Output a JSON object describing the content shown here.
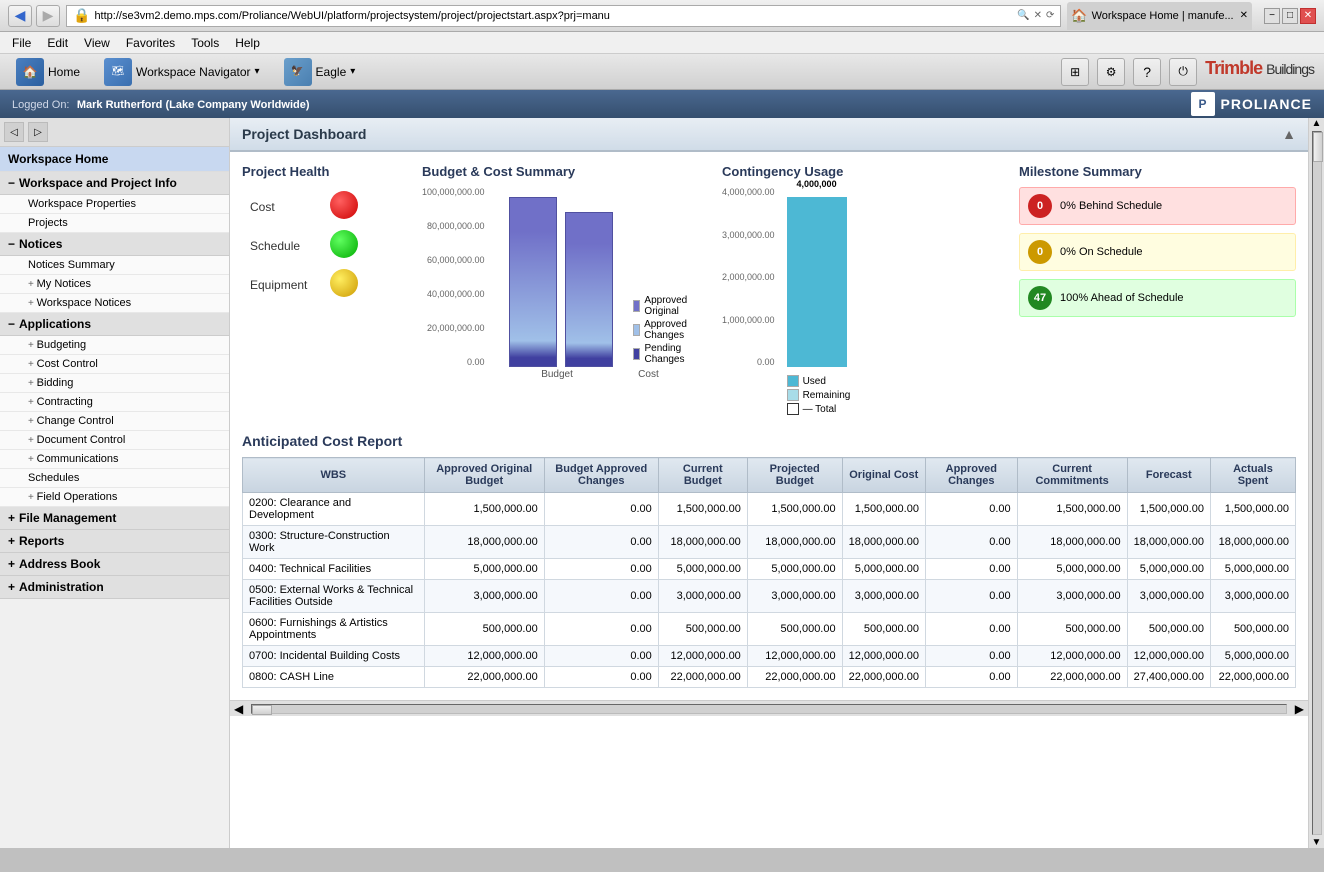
{
  "browser": {
    "url": "http://se3vm2.demo.mps.com/Proliance/WebUI/platform/projectsystem/project/projectstart.aspx?prj=manu",
    "tab_label": "Workspace Home | manufe...",
    "title_bar": {
      "minimize": "−",
      "maximize": "□",
      "close": "✕"
    },
    "menu": [
      "File",
      "Edit",
      "View",
      "Favorites",
      "Tools",
      "Help"
    ]
  },
  "toolbar": {
    "home_label": "Home",
    "workspace_navigator_label": "Workspace Navigator",
    "eagle_label": "Eagle"
  },
  "header": {
    "logged_on_label": "Logged On:",
    "user": "Mark Rutherford (Lake Company Worldwide)",
    "proliance_label": "PROLIANCE"
  },
  "sidebar": {
    "workspace_home": "Workspace Home",
    "sections": [
      {
        "label": "Workspace and Project Info",
        "items": [
          "Workspace Properties",
          "Projects"
        ]
      },
      {
        "label": "Notices",
        "items": [
          "Notices Summary",
          "My Notices",
          "Workspace Notices"
        ]
      },
      {
        "label": "Applications",
        "items": [
          "Budgeting",
          "Cost Control",
          "Bidding",
          "Contracting",
          "Change Control",
          "Document Control",
          "Communications",
          "Schedules",
          "Field Operations"
        ]
      },
      {
        "label": "File Management",
        "items": []
      },
      {
        "label": "Reports",
        "items": []
      },
      {
        "label": "Address Book",
        "items": []
      },
      {
        "label": "Administration",
        "items": []
      }
    ]
  },
  "content": {
    "title": "Project Dashboard",
    "project_health": {
      "title": "Project Health",
      "rows": [
        {
          "label": "Cost",
          "status": "red"
        },
        {
          "label": "Schedule",
          "status": "green"
        },
        {
          "label": "Equipment",
          "status": "yellow"
        }
      ]
    },
    "budget_chart": {
      "title": "Budget & Cost Summary",
      "y_labels": [
        "100,000,000.00",
        "80,000,000.00",
        "60,000,000.00",
        "40,000,000.00",
        "20,000,000.00",
        "0.00"
      ],
      "x_labels": [
        "Budget",
        "Cost"
      ],
      "legend": [
        {
          "label": "Approved Original",
          "color": "#7070c8"
        },
        {
          "label": "Approved Changes",
          "color": "#a0c0e8"
        },
        {
          "label": "Pending Changes",
          "color": "#4040a0"
        }
      ],
      "bars": {
        "budget_height": 0.95,
        "cost_height": 0.87
      }
    },
    "contingency": {
      "title": "Contingency Usage",
      "y_labels": [
        "4,000,000.00",
        "3,000,000.00",
        "2,000,000.00",
        "1,000,000.00",
        "0.00"
      ],
      "top_label": "4,000,000",
      "legend": [
        {
          "label": "Used",
          "color": "#4db8d4"
        },
        {
          "label": "Remaining",
          "color": "#a8dce8"
        },
        {
          "label": "Total",
          "type": "line"
        }
      ],
      "bar_height": 1.0
    },
    "milestone": {
      "title": "Milestone Summary",
      "items": [
        {
          "badge": "0",
          "text": "0% Behind Schedule",
          "color": "red"
        },
        {
          "badge": "0",
          "text": "0% On Schedule",
          "color": "yellow"
        },
        {
          "badge": "47",
          "text": "100% Ahead of Schedule",
          "color": "green"
        }
      ]
    },
    "acr_title": "Anticipated Cost Report",
    "table": {
      "headers": [
        "WBS",
        "Approved Original Budget",
        "Budget Approved Changes",
        "Current Budget",
        "Projected Budget",
        "Original Cost",
        "Approved Changes",
        "Current Commitments",
        "Forecast",
        "Actuals Spent"
      ],
      "rows": [
        {
          "wbs": "0200: Clearance and Development",
          "approved_original": "1,500,000.00",
          "budget_approved": "0.00",
          "current_budget": "1,500,000.00",
          "projected_budget": "1,500,000.00",
          "original_cost": "1,500,000.00",
          "approved_changes": "0.00",
          "current_commitments": "1,500,000.00",
          "forecast": "1,500,000.00",
          "actuals_spent": "1,500,000.00"
        },
        {
          "wbs": "0300: Structure-Construction Work",
          "approved_original": "18,000,000.00",
          "budget_approved": "0.00",
          "current_budget": "18,000,000.00",
          "projected_budget": "18,000,000.00",
          "original_cost": "18,000,000.00",
          "approved_changes": "0.00",
          "current_commitments": "18,000,000.00",
          "forecast": "18,000,000.00",
          "actuals_spent": "18,000,000.00"
        },
        {
          "wbs": "0400: Technical Facilities",
          "approved_original": "5,000,000.00",
          "budget_approved": "0.00",
          "current_budget": "5,000,000.00",
          "projected_budget": "5,000,000.00",
          "original_cost": "5,000,000.00",
          "approved_changes": "0.00",
          "current_commitments": "5,000,000.00",
          "forecast": "5,000,000.00",
          "actuals_spent": "5,000,000.00"
        },
        {
          "wbs": "0500: External Works & Technical Facilities Outside",
          "approved_original": "3,000,000.00",
          "budget_approved": "0.00",
          "current_budget": "3,000,000.00",
          "projected_budget": "3,000,000.00",
          "original_cost": "3,000,000.00",
          "approved_changes": "0.00",
          "current_commitments": "3,000,000.00",
          "forecast": "3,000,000.00",
          "actuals_spent": "3,000,000.00"
        },
        {
          "wbs": "0600: Furnishings & Artistics Appointments",
          "approved_original": "500,000.00",
          "budget_approved": "0.00",
          "current_budget": "500,000.00",
          "projected_budget": "500,000.00",
          "original_cost": "500,000.00",
          "approved_changes": "0.00",
          "current_commitments": "500,000.00",
          "forecast": "500,000.00",
          "actuals_spent": "500,000.00"
        },
        {
          "wbs": "0700: Incidental Building Costs",
          "approved_original": "12,000,000.00",
          "budget_approved": "0.00",
          "current_budget": "12,000,000.00",
          "projected_budget": "12,000,000.00",
          "original_cost": "12,000,000.00",
          "approved_changes": "0.00",
          "current_commitments": "12,000,000.00",
          "forecast": "12,000,000.00",
          "actuals_spent": "5,000,000.00"
        },
        {
          "wbs": "0800: CASH Line",
          "approved_original": "22,000,000.00",
          "budget_approved": "0.00",
          "current_budget": "22,000,000.00",
          "projected_budget": "22,000,000.00",
          "original_cost": "22,000,000.00",
          "approved_changes": "0.00",
          "current_commitments": "22,000,000.00",
          "forecast": "27,400,000.00",
          "actuals_spent": "22,000,000.00"
        }
      ]
    }
  },
  "trimble": {
    "label": "Trimble Buildings"
  }
}
